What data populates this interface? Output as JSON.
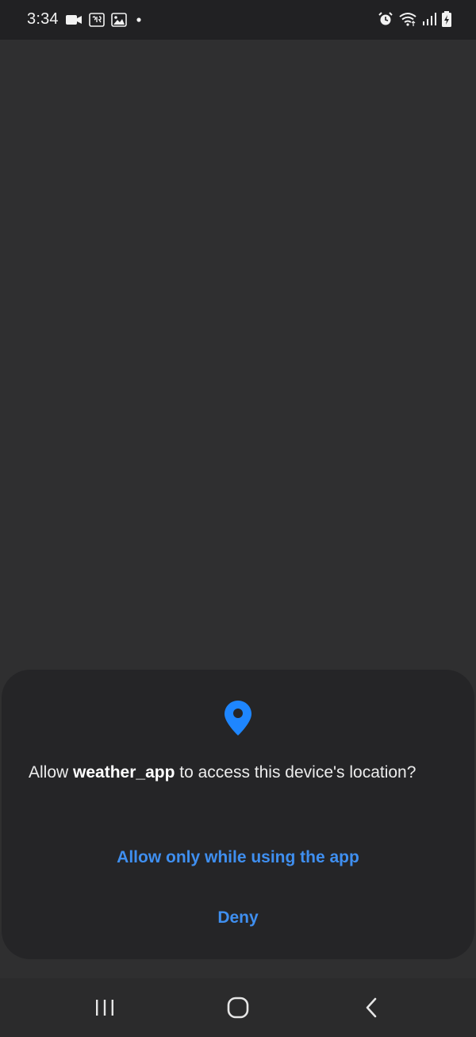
{
  "status_bar": {
    "time": "3:34",
    "icons": [
      "video-camera-icon",
      "notification-app-icon",
      "gallery-icon",
      "dot-icon",
      "alarm-icon",
      "wifi-icon",
      "signal-icon",
      "battery-icon"
    ]
  },
  "dialog": {
    "icon": "location-pin-icon",
    "message_prefix": "Allow ",
    "app_name": "weather_app",
    "message_suffix": " to access this device's location?",
    "allow_label": "Allow only while using the app",
    "deny_label": "Deny"
  },
  "navigation": {
    "recents": "recents-icon",
    "home": "home-icon",
    "back": "back-icon"
  },
  "colors": {
    "accent": "#3f8ff0",
    "location_icon": "#1e86ff",
    "dialog_bg": "#252527",
    "screen_bg": "#2f2f30"
  }
}
